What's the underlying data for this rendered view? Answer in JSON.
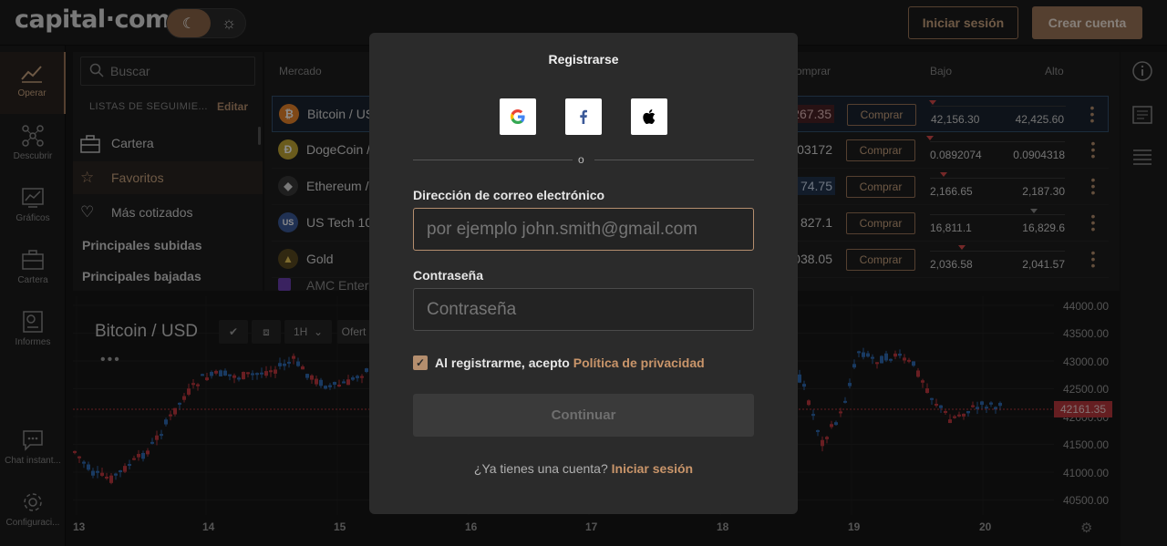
{
  "header": {
    "logo": "capital·com",
    "login_label": "Iniciar sesión",
    "signup_label": "Crear cuenta"
  },
  "nav": [
    {
      "label": "Operar",
      "icon": "trend-icon"
    },
    {
      "label": "Descubrir",
      "icon": "network-icon"
    },
    {
      "label": "Gráficos",
      "icon": "chart-icon"
    },
    {
      "label": "Cartera",
      "icon": "briefcase-icon"
    },
    {
      "label": "Informes",
      "icon": "report-icon"
    },
    {
      "label": "Chat instant...",
      "icon": "chat-icon"
    },
    {
      "label": "Configuraci...",
      "icon": "gear-icon"
    }
  ],
  "search": {
    "placeholder": "Buscar"
  },
  "watchlists": {
    "heading": "LISTAS DE SEGUIMIE...",
    "edit_label": "Editar",
    "items": [
      {
        "label": "Cartera",
        "icon": "briefcase-icon"
      },
      {
        "label": "Favoritos",
        "icon": "star-icon"
      },
      {
        "label": "Más cotizados",
        "icon": "heart-icon"
      },
      {
        "label": "Principales subidas"
      },
      {
        "label": "Principales bajadas"
      }
    ]
  },
  "table": {
    "headers": {
      "market": "Mercado",
      "buy": "omprar",
      "low": "Bajo",
      "high": "Alto"
    },
    "rows": [
      {
        "name": "Bitcoin / US",
        "price": "267.35",
        "buy": "Comprar",
        "low": "42,156.30",
        "high": "42,425.60",
        "icon": "bitcoin-icon",
        "icon_color": "#e8832b"
      },
      {
        "name": "DogeCoin /",
        "price": "03172",
        "buy": "Comprar",
        "low": "0.0892074",
        "high": "0.0904318",
        "icon": "dogecoin-icon",
        "icon_color": "#c2a633"
      },
      {
        "name": "Ethereum /",
        "price": "74.75",
        "buy": "Comprar",
        "low": "2,166.65",
        "high": "2,187.30",
        "icon": "ethereum-icon",
        "icon_color": "#3a3a3a"
      },
      {
        "name": "US Tech 10",
        "price": "827.1",
        "buy": "Comprar",
        "low": "16,811.1",
        "high": "16,829.6",
        "icon": "us-flag-icon",
        "icon_color": "#3b5998"
      },
      {
        "name": "Gold",
        "price": "038.05",
        "buy": "Comprar",
        "low": "2,036.58",
        "high": "2,041.57",
        "icon": "gold-icon",
        "icon_color": "#c8a23a"
      },
      {
        "name": "AMC Enter",
        "price": "",
        "buy": "",
        "low": "",
        "high": "",
        "icon": "amc-icon",
        "icon_color": "#6a3fb0"
      }
    ]
  },
  "chart": {
    "title": "Bitcoin / USD",
    "interval": "1H",
    "offer_label": "Ofert",
    "current_price": "42161.35",
    "y_labels": [
      "44000.00",
      "43500.00",
      "43000.00",
      "42500.00",
      "42000.00",
      "41500.00",
      "41000.00",
      "40500.00"
    ],
    "x_labels": [
      "13",
      "14",
      "15",
      "16",
      "17",
      "18",
      "19",
      "20"
    ],
    "colors": {
      "up": "#2e6bb3",
      "down": "#c0383e"
    }
  },
  "modal": {
    "title": "Registrarse",
    "divider": "o",
    "email_label": "Dirección de correo electrónico",
    "email_placeholder": "por ejemplo john.smith@gmail.com",
    "password_label": "Contraseña",
    "password_placeholder": "Contraseña",
    "consent_text": "Al registrarme, acepto ",
    "consent_link": "Política de privacidad",
    "continue_label": "Continuar",
    "have_account_text": "¿Ya tienes una cuenta? ",
    "have_account_link": "Iniciar sesión",
    "social": [
      "google-icon",
      "facebook-icon",
      "apple-icon"
    ]
  }
}
